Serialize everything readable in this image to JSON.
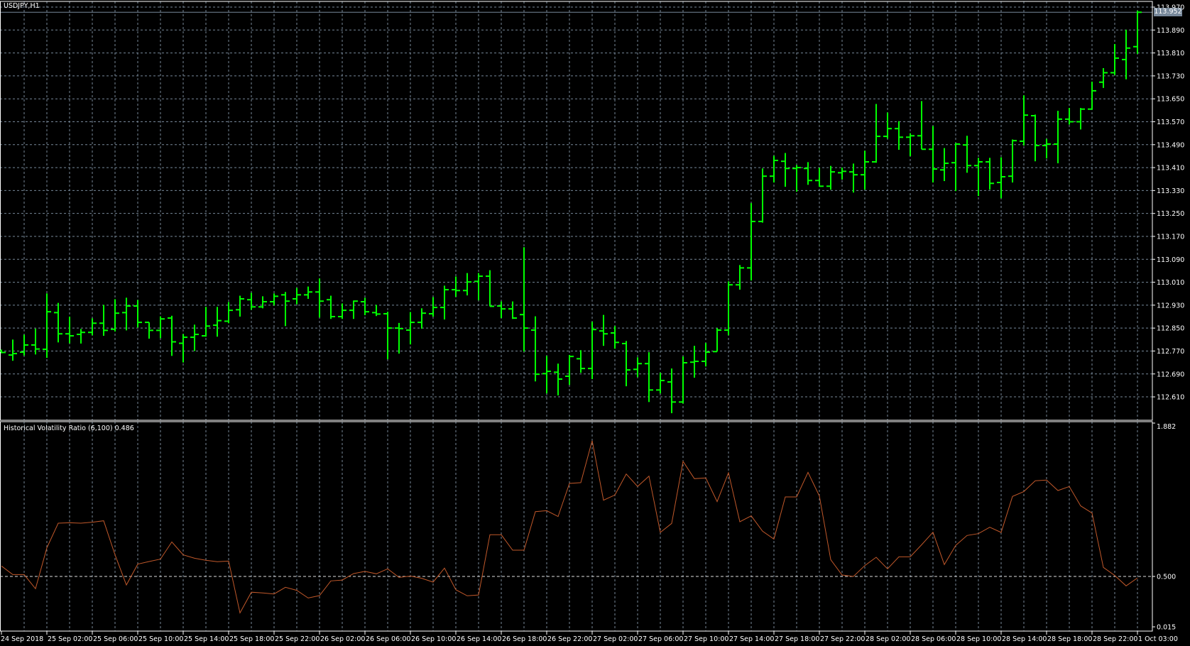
{
  "chart_title": "USDJPY,H1",
  "current_price": "113.952",
  "colors": {
    "background": "#000000",
    "bars": "#00ff00",
    "grid": "#778899",
    "indicator": "#c0582a",
    "axis": "#ffffff",
    "price_tag": "#77889a"
  },
  "indicator": {
    "title": "Historical Volatility Ratio (6,100) 0.486",
    "axis_labels": [
      "1.882",
      "0.500",
      "0.015"
    ]
  },
  "chart_data": [
    {
      "type": "ohlc",
      "title": "USDJPY,H1",
      "ylim": [
        112.55,
        113.97
      ],
      "y_tick_labels": [
        "113.970",
        "113.890",
        "113.810",
        "113.730",
        "113.650",
        "113.570",
        "113.490",
        "113.410",
        "113.330",
        "113.250",
        "113.170",
        "113.090",
        "113.010",
        "112.930",
        "112.850",
        "112.770",
        "112.690",
        "112.610"
      ],
      "x_tick_labels": [
        "24 Sep 2018",
        "25 Sep 02:00",
        "25 Sep 06:00",
        "25 Sep 10:00",
        "25 Sep 14:00",
        "25 Sep 18:00",
        "25 Sep 22:00",
        "26 Sep 02:00",
        "26 Sep 06:00",
        "26 Sep 10:00",
        "26 Sep 14:00",
        "26 Sep 18:00",
        "26 Sep 22:00",
        "27 Sep 02:00",
        "27 Sep 06:00",
        "27 Sep 10:00",
        "27 Sep 14:00",
        "27 Sep 18:00",
        "27 Sep 22:00",
        "28 Sep 02:00",
        "28 Sep 06:00",
        "28 Sep 10:00",
        "28 Sep 14:00",
        "28 Sep 18:00",
        "28 Sep 22:00",
        "1 Oct 03:00"
      ],
      "grid": true,
      "bars_ohlc": [
        [
          112.77,
          112.775,
          112.762,
          112.765
        ],
        [
          112.756,
          112.81,
          112.736,
          112.761
        ],
        [
          112.766,
          112.827,
          112.754,
          112.791
        ],
        [
          112.791,
          112.848,
          112.758,
          112.777
        ],
        [
          112.776,
          112.971,
          112.746,
          112.907
        ],
        [
          112.904,
          112.938,
          112.8,
          112.83
        ],
        [
          112.83,
          112.89,
          112.797,
          112.823
        ],
        [
          112.828,
          112.847,
          112.796,
          112.835
        ],
        [
          112.835,
          112.884,
          112.825,
          112.867
        ],
        [
          112.867,
          112.931,
          112.823,
          112.842
        ],
        [
          112.846,
          112.951,
          112.838,
          112.902
        ],
        [
          112.904,
          112.956,
          112.842,
          112.927
        ],
        [
          112.927,
          112.948,
          112.852,
          112.87
        ],
        [
          112.87,
          112.87,
          112.813,
          112.842
        ],
        [
          112.842,
          112.891,
          112.815,
          112.882
        ],
        [
          112.885,
          112.893,
          112.753,
          112.802
        ],
        [
          112.797,
          112.829,
          112.73,
          112.818
        ],
        [
          112.818,
          112.862,
          112.77,
          112.828
        ],
        [
          112.823,
          112.924,
          112.82,
          112.857
        ],
        [
          112.86,
          112.924,
          112.82,
          112.876
        ],
        [
          112.874,
          112.941,
          112.867,
          112.912
        ],
        [
          112.914,
          112.963,
          112.89,
          112.952
        ],
        [
          112.949,
          112.973,
          112.914,
          112.924
        ],
        [
          112.924,
          112.961,
          112.919,
          112.942
        ],
        [
          112.942,
          112.971,
          112.929,
          112.961
        ],
        [
          112.966,
          112.976,
          112.857,
          112.944
        ],
        [
          112.952,
          112.99,
          112.933,
          112.966
        ],
        [
          112.966,
          112.995,
          112.952,
          112.976
        ],
        [
          112.976,
          113.023,
          112.887,
          112.944
        ],
        [
          112.949,
          112.963,
          112.882,
          112.89
        ],
        [
          112.89,
          112.936,
          112.882,
          112.912
        ],
        [
          112.912,
          112.946,
          112.882,
          112.944
        ],
        [
          112.942,
          112.956,
          112.895,
          112.907
        ],
        [
          112.904,
          112.931,
          112.892,
          112.899
        ],
        [
          112.9,
          112.907,
          112.741,
          112.85
        ],
        [
          112.85,
          112.868,
          112.761,
          112.848
        ],
        [
          112.843,
          112.906,
          112.793,
          112.87
        ],
        [
          112.87,
          112.919,
          112.848,
          112.902
        ],
        [
          112.9,
          112.958,
          112.89,
          112.922
        ],
        [
          112.922,
          112.998,
          112.88,
          112.984
        ],
        [
          112.984,
          113.03,
          112.959,
          112.981
        ],
        [
          112.981,
          113.042,
          112.964,
          113.011
        ],
        [
          113.013,
          113.042,
          112.947,
          113.031
        ],
        [
          113.031,
          113.052,
          112.926,
          112.926
        ],
        [
          112.927,
          112.943,
          112.885,
          112.917
        ],
        [
          112.917,
          112.943,
          112.882,
          112.885
        ],
        [
          112.897,
          113.132,
          112.768,
          112.85
        ],
        [
          112.843,
          112.891,
          112.664,
          112.689
        ],
        [
          112.691,
          112.753,
          112.622,
          112.699
        ],
        [
          112.696,
          112.726,
          112.615,
          112.672
        ],
        [
          112.682,
          112.756,
          112.652,
          112.751
        ],
        [
          112.743,
          112.773,
          112.694,
          112.709
        ],
        [
          112.709,
          112.872,
          112.672,
          112.845
        ],
        [
          112.84,
          112.896,
          112.788,
          112.83
        ],
        [
          112.833,
          112.857,
          112.778,
          112.8
        ],
        [
          112.796,
          112.805,
          112.647,
          112.704
        ],
        [
          112.706,
          112.748,
          112.679,
          112.726
        ],
        [
          112.726,
          112.766,
          112.592,
          112.634
        ],
        [
          112.634,
          112.694,
          112.622,
          112.667
        ],
        [
          112.662,
          112.709,
          112.553,
          112.592
        ],
        [
          112.592,
          112.751,
          112.587,
          112.729
        ],
        [
          112.731,
          112.788,
          112.677,
          112.734
        ],
        [
          112.734,
          112.798,
          112.716,
          112.766
        ],
        [
          112.768,
          112.85,
          112.768,
          112.843
        ],
        [
          112.843,
          113.013,
          112.825,
          113.001
        ],
        [
          113.001,
          113.07,
          112.984,
          113.06
        ],
        [
          113.06,
          113.286,
          113.016,
          113.222
        ],
        [
          113.222,
          113.407,
          113.218,
          113.38
        ],
        [
          113.38,
          113.451,
          113.358,
          113.435
        ],
        [
          113.432,
          113.461,
          113.343,
          113.407
        ],
        [
          113.407,
          113.419,
          113.326,
          113.41
        ],
        [
          113.407,
          113.429,
          113.35,
          113.365
        ],
        [
          113.365,
          113.409,
          113.343,
          113.345
        ],
        [
          113.345,
          113.416,
          113.333,
          113.395
        ],
        [
          113.392,
          113.41,
          113.368,
          113.397
        ],
        [
          113.395,
          113.424,
          113.323,
          113.385
        ],
        [
          113.385,
          113.469,
          113.333,
          113.43
        ],
        [
          113.43,
          113.632,
          113.427,
          113.519
        ],
        [
          113.519,
          113.602,
          113.511,
          113.546
        ],
        [
          113.546,
          113.572,
          113.472,
          113.516
        ],
        [
          113.516,
          113.53,
          113.45,
          113.521
        ],
        [
          113.521,
          113.642,
          113.474,
          113.474
        ],
        [
          113.474,
          113.555,
          113.358,
          113.405
        ],
        [
          113.402,
          113.478,
          113.363,
          113.425
        ],
        [
          113.427,
          113.496,
          113.328,
          113.492
        ],
        [
          113.489,
          113.521,
          113.392,
          113.417
        ],
        [
          113.417,
          113.444,
          113.311,
          113.43
        ],
        [
          113.43,
          113.444,
          113.333,
          113.355
        ],
        [
          113.358,
          113.446,
          113.303,
          113.378
        ],
        [
          113.38,
          113.508,
          113.358,
          113.504
        ],
        [
          113.502,
          113.662,
          113.487,
          113.593
        ],
        [
          113.591,
          113.595,
          113.432,
          113.487
        ],
        [
          113.487,
          113.51,
          113.442,
          113.492
        ],
        [
          113.492,
          113.608,
          113.425,
          113.579
        ],
        [
          113.579,
          113.618,
          113.56,
          113.57
        ],
        [
          113.57,
          113.618,
          113.543,
          113.614
        ],
        [
          113.614,
          113.71,
          113.612,
          113.678
        ],
        [
          113.708,
          113.757,
          113.688,
          113.741
        ],
        [
          113.741,
          113.841,
          113.733,
          113.792
        ],
        [
          113.787,
          113.891,
          113.718,
          113.827
        ],
        [
          113.832,
          113.957,
          113.807,
          113.952
        ]
      ]
    },
    {
      "type": "line",
      "title": "Historical Volatility Ratio (6,100) 0.486",
      "ylim": [
        0.015,
        1.882
      ],
      "reference_level": 0.5,
      "values": [
        0.596,
        0.517,
        0.517,
        0.387,
        0.763,
        0.989,
        0.993,
        0.989,
        0.998,
        1.011,
        0.698,
        0.422,
        0.613,
        0.637,
        0.659,
        0.817,
        0.698,
        0.667,
        0.648,
        0.635,
        0.641,
        0.165,
        0.355,
        0.348,
        0.339,
        0.4,
        0.372,
        0.302,
        0.324,
        0.459,
        0.467,
        0.526,
        0.546,
        0.524,
        0.57,
        0.491,
        0.503,
        0.483,
        0.448,
        0.576,
        0.378,
        0.322,
        0.33,
        0.883,
        0.883,
        0.741,
        0.741,
        1.095,
        1.104,
        1.05,
        1.354,
        1.361,
        1.747,
        1.2,
        1.248,
        1.441,
        1.326,
        1.421,
        0.904,
        0.987,
        1.556,
        1.398,
        1.404,
        1.187,
        1.452,
        1.002,
        1.056,
        0.915,
        0.843,
        1.23,
        1.23,
        1.456,
        1.239,
        0.654,
        0.513,
        0.5,
        0.6,
        0.676,
        0.57,
        0.68,
        0.68,
        0.791,
        0.906,
        0.609,
        0.785,
        0.876,
        0.893,
        0.952,
        0.904,
        1.235,
        1.28,
        1.378,
        1.385,
        1.289,
        1.326,
        1.148,
        1.082,
        0.583,
        0.509,
        0.413,
        0.486
      ]
    }
  ]
}
